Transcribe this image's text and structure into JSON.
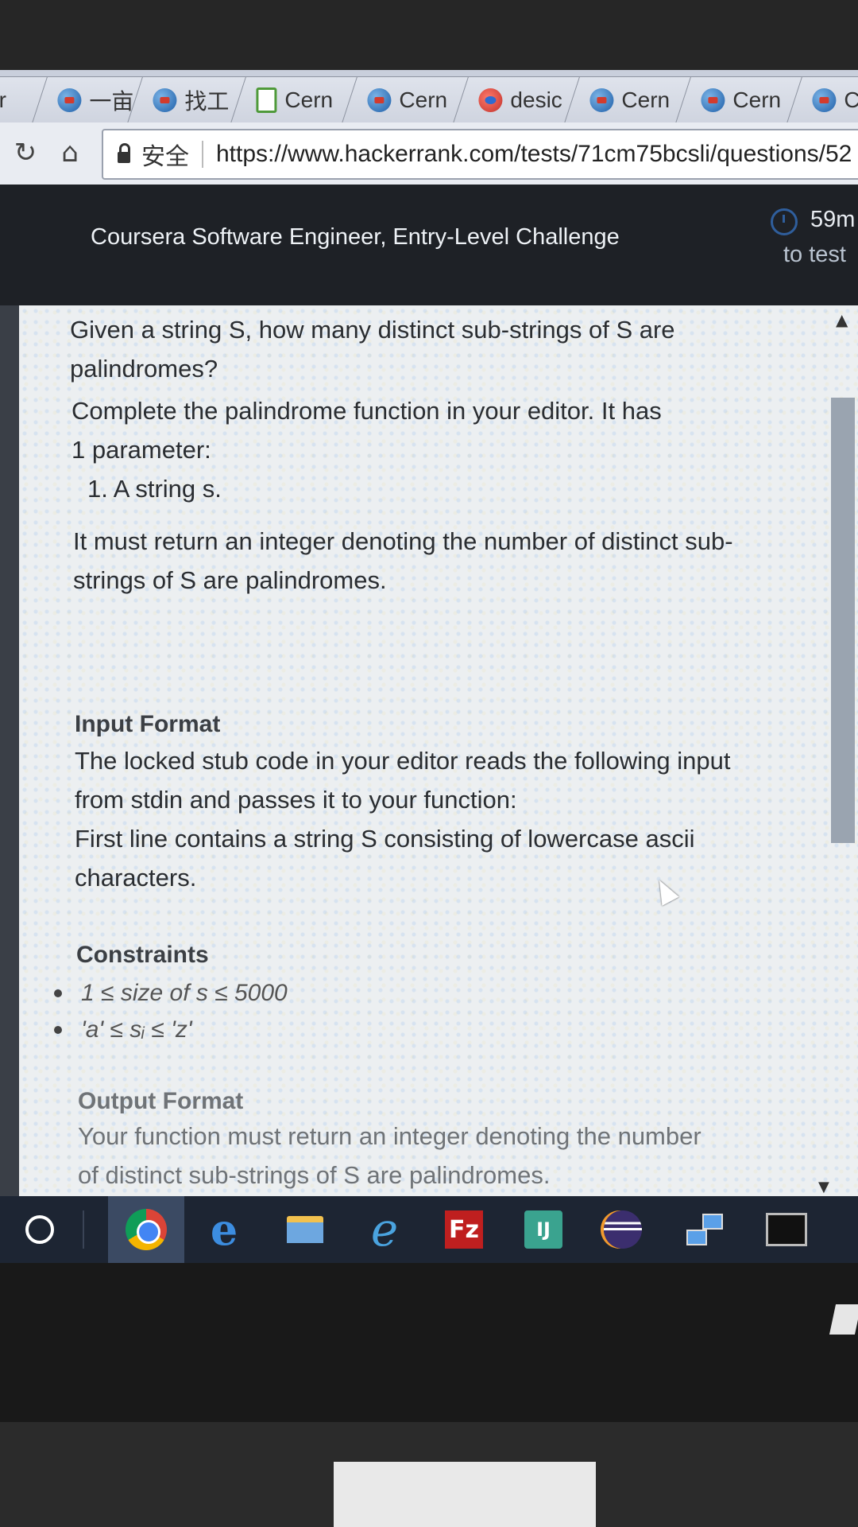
{
  "browser": {
    "tabs": [
      {
        "label": "ir",
        "icon": "none"
      },
      {
        "label": "一亩",
        "icon": "site-icon"
      },
      {
        "label": "找工",
        "icon": "site-icon"
      },
      {
        "label": "Cern",
        "icon": "doc-icon"
      },
      {
        "label": "Cern",
        "icon": "site-icon"
      },
      {
        "label": "desic",
        "icon": "sync-icon"
      },
      {
        "label": "Cern",
        "icon": "site-icon"
      },
      {
        "label": "Cern",
        "icon": "site-icon"
      },
      {
        "label": "Ce",
        "icon": "site-icon"
      }
    ],
    "secure_label": "安全",
    "url": "https://www.hackerrank.com/tests/71cm75bcsli/questions/52"
  },
  "header": {
    "title": "Coursera Software Engineer, Entry-Level Challenge",
    "timer_value": "59m",
    "timer_caption": "to test"
  },
  "problem": {
    "p1_line1": "Given a string S, how many distinct sub-strings of S are",
    "p1_line2": "palindromes?",
    "p2_line1": "Complete the palindrome function in your editor. It has",
    "p2_line2": "1 parameter:",
    "p2_line3": "1. A string s.",
    "p3_line1": "It must return an integer denoting the number of distinct sub-",
    "p3_line2": "strings of S are palindromes.",
    "input_heading": "Input Format",
    "input_line1": "The locked stub code in your editor reads the following input",
    "input_line2": "from stdin and passes it to your function:",
    "input_line3": "First line contains a string S consisting of lowercase ascii",
    "input_line4": "characters.",
    "constraints_heading": "Constraints",
    "constraint1": "1 ≤ size of s ≤ 5000",
    "constraint2": "'a' ≤ sᵢ ≤ 'z'",
    "output_heading": "Output Format",
    "output_line1": "Your function must return an integer denoting the number",
    "output_line2": "of distinct sub-strings of S are palindromes."
  },
  "taskbar": {
    "items": [
      "cortana-icon",
      "chrome-icon",
      "edge-icon",
      "file-explorer-icon",
      "internet-explorer-icon",
      "filezilla-icon",
      "jetbrains-icon",
      "eclipse-icon",
      "network-icon",
      "command-prompt-icon"
    ],
    "fz_text": "Fz",
    "jb_text": "IJ"
  }
}
